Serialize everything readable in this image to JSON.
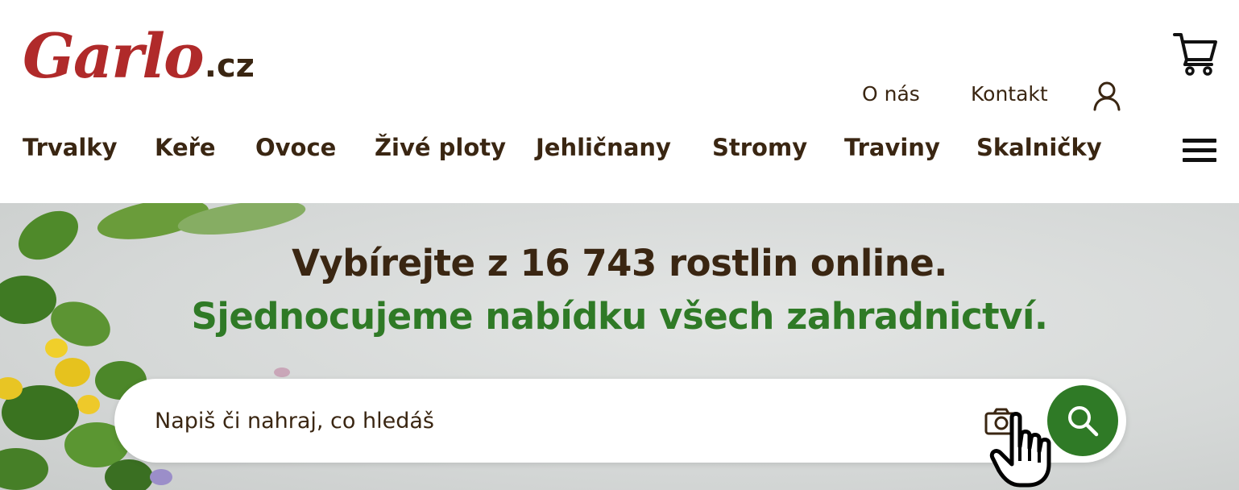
{
  "header": {
    "logo": {
      "main": "Garlo",
      "tld": ".cz"
    },
    "top_links": {
      "about": "O nás",
      "contact": "Kontakt"
    },
    "nav": [
      "Trvalky",
      "Keře",
      "Ovoce",
      "Živé ploty",
      "Jehličnany",
      "Stromy",
      "Traviny",
      "Skalničky"
    ]
  },
  "hero": {
    "title": "Vybírejte z 16 743 rostlin online.",
    "subtitle": "Sjednocujeme nabídku všech zahradnictví.",
    "search": {
      "placeholder": "Napiš či nahraj, co hledáš",
      "value": ""
    }
  },
  "icons": {
    "cart": "cart-icon",
    "user": "user-icon",
    "menu": "hamburger-menu-icon",
    "camera": "camera-icon",
    "search": "search-icon",
    "cursor": "hand-pointer-cursor"
  },
  "colors": {
    "brand_red": "#b02a2a",
    "brand_green": "#2f7a26",
    "text_brown": "#3a2612"
  }
}
